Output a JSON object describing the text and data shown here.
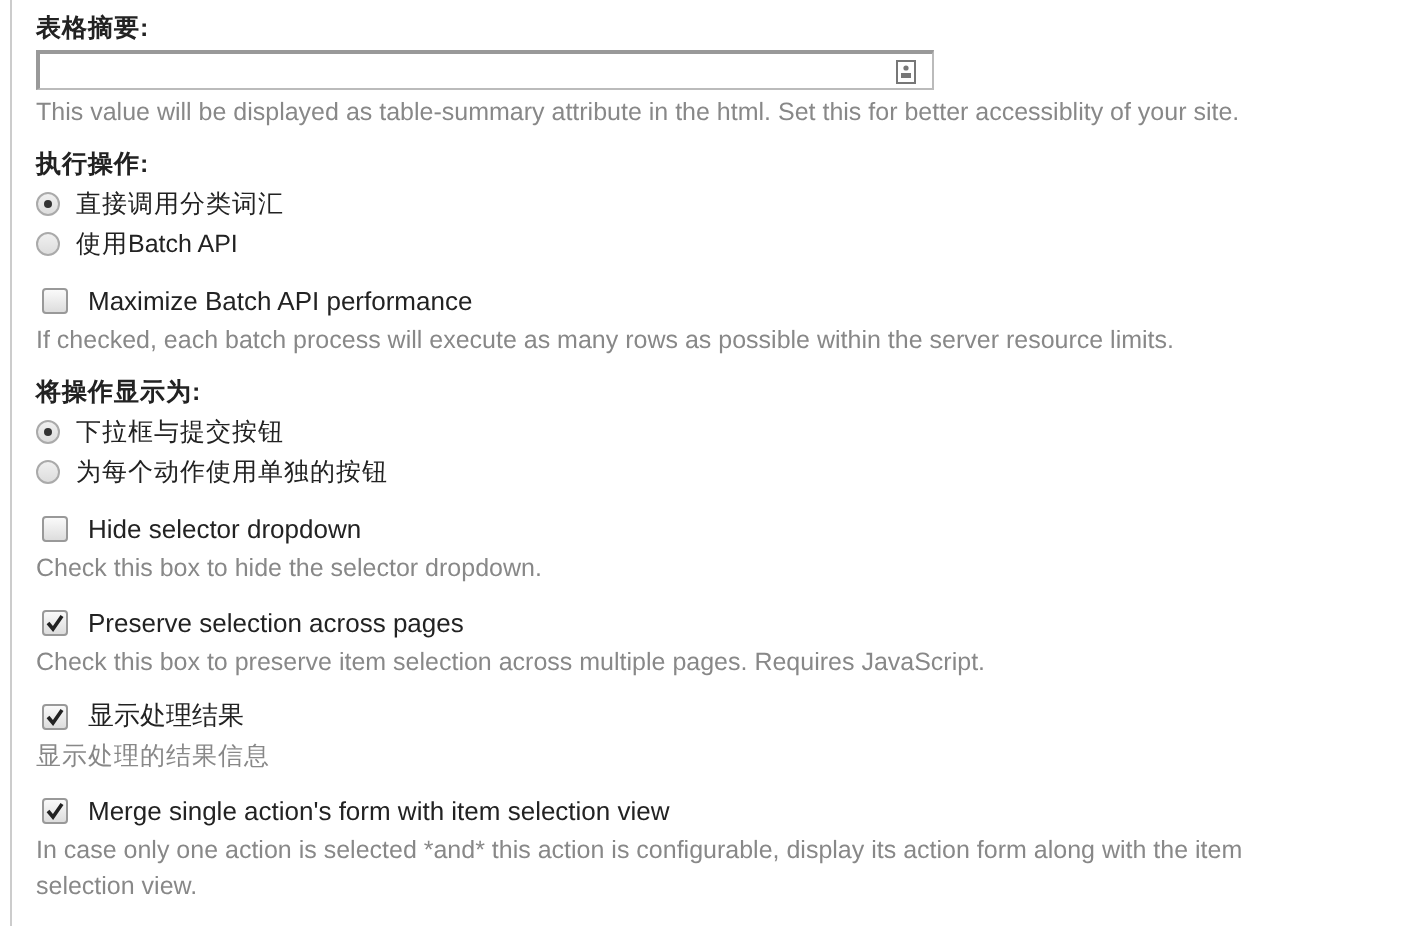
{
  "form": [
    {
      "kind": "text_field",
      "label": "表格摘要:",
      "description": "This value will be displayed as table-summary attribute in the html. Set this for better accessiblity of your site."
    },
    {
      "kind": "radio_group",
      "label": "执行操作:",
      "options": [
        {
          "label": "直接调用分类词汇",
          "selected": true
        },
        {
          "label": "使用Batch API",
          "selected": false
        }
      ]
    },
    {
      "kind": "checkbox",
      "label": "Maximize Batch API performance",
      "checked": false,
      "description": "If checked, each batch process will execute as many rows as possible within the server resource limits."
    },
    {
      "kind": "radio_group",
      "label": "将操作显示为:",
      "options": [
        {
          "label": "下拉框与提交按钮",
          "selected": true
        },
        {
          "label": "为每个动作使用单独的按钮",
          "selected": false
        }
      ]
    },
    {
      "kind": "checkbox",
      "label": "Hide selector dropdown",
      "checked": false,
      "description": "Check this box to hide the selector dropdown."
    },
    {
      "kind": "checkbox",
      "label": "Preserve selection across pages",
      "checked": true,
      "description": "Check this box to preserve item selection across multiple pages. Requires JavaScript."
    },
    {
      "kind": "checkbox",
      "label": "显示处理结果",
      "checked": true,
      "description": "显示处理的结果信息"
    },
    {
      "kind": "checkbox",
      "label": "Merge single action's form with item selection view",
      "checked": true,
      "description": "In case only one action is selected *and* this action is configurable, display its action form along with the item selection view."
    }
  ]
}
